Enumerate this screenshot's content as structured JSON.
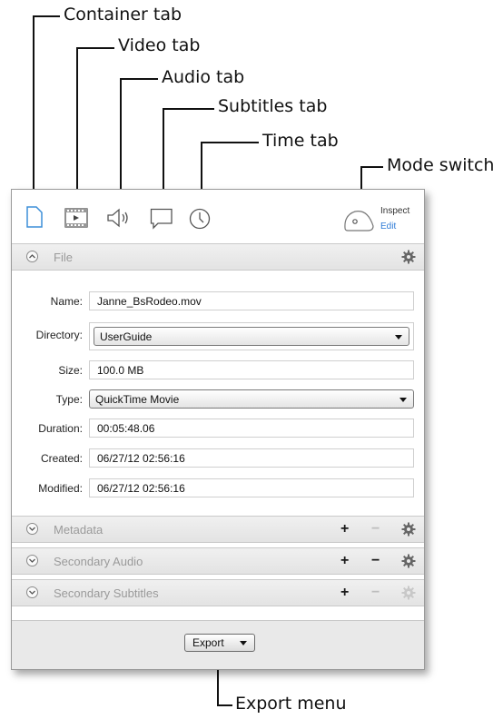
{
  "callouts": {
    "container_tab": "Container tab",
    "video_tab": "Video tab",
    "audio_tab": "Audio tab",
    "subtitles_tab": "Subtitles tab",
    "time_tab": "Time tab",
    "mode_switch": "Mode switch",
    "export_menu": "Export menu"
  },
  "toolbar": {
    "tabs": [
      "container-icon",
      "video-icon",
      "audio-icon",
      "subtitles-icon",
      "time-icon"
    ],
    "selected_tab_color": "#3d8fd8",
    "mode_switch": {
      "inspect_label": "Inspect",
      "edit_label": "Edit",
      "edit_color": "#2e7bd6"
    }
  },
  "file_section": {
    "title": "File",
    "fields": {
      "name_label": "Name:",
      "name_value": "Janne_BsRodeo.mov",
      "directory_label": "Directory:",
      "directory_value": "UserGuide",
      "size_label": "Size:",
      "size_value": "100.0 MB",
      "type_label": "Type:",
      "type_value": "QuickTime Movie",
      "duration_label": "Duration:",
      "duration_value": "00:05:48.06",
      "created_label": "Created:",
      "created_value": "06/27/12 02:56:16",
      "modified_label": "Modified:",
      "modified_value": "06/27/12 02:56:16"
    }
  },
  "sections": {
    "metadata": "Metadata",
    "secondary_audio": "Secondary Audio",
    "secondary_subtitles": "Secondary Subtitles",
    "add_symbol": "+",
    "remove_symbol": "−"
  },
  "footer": {
    "export_label": "Export"
  }
}
